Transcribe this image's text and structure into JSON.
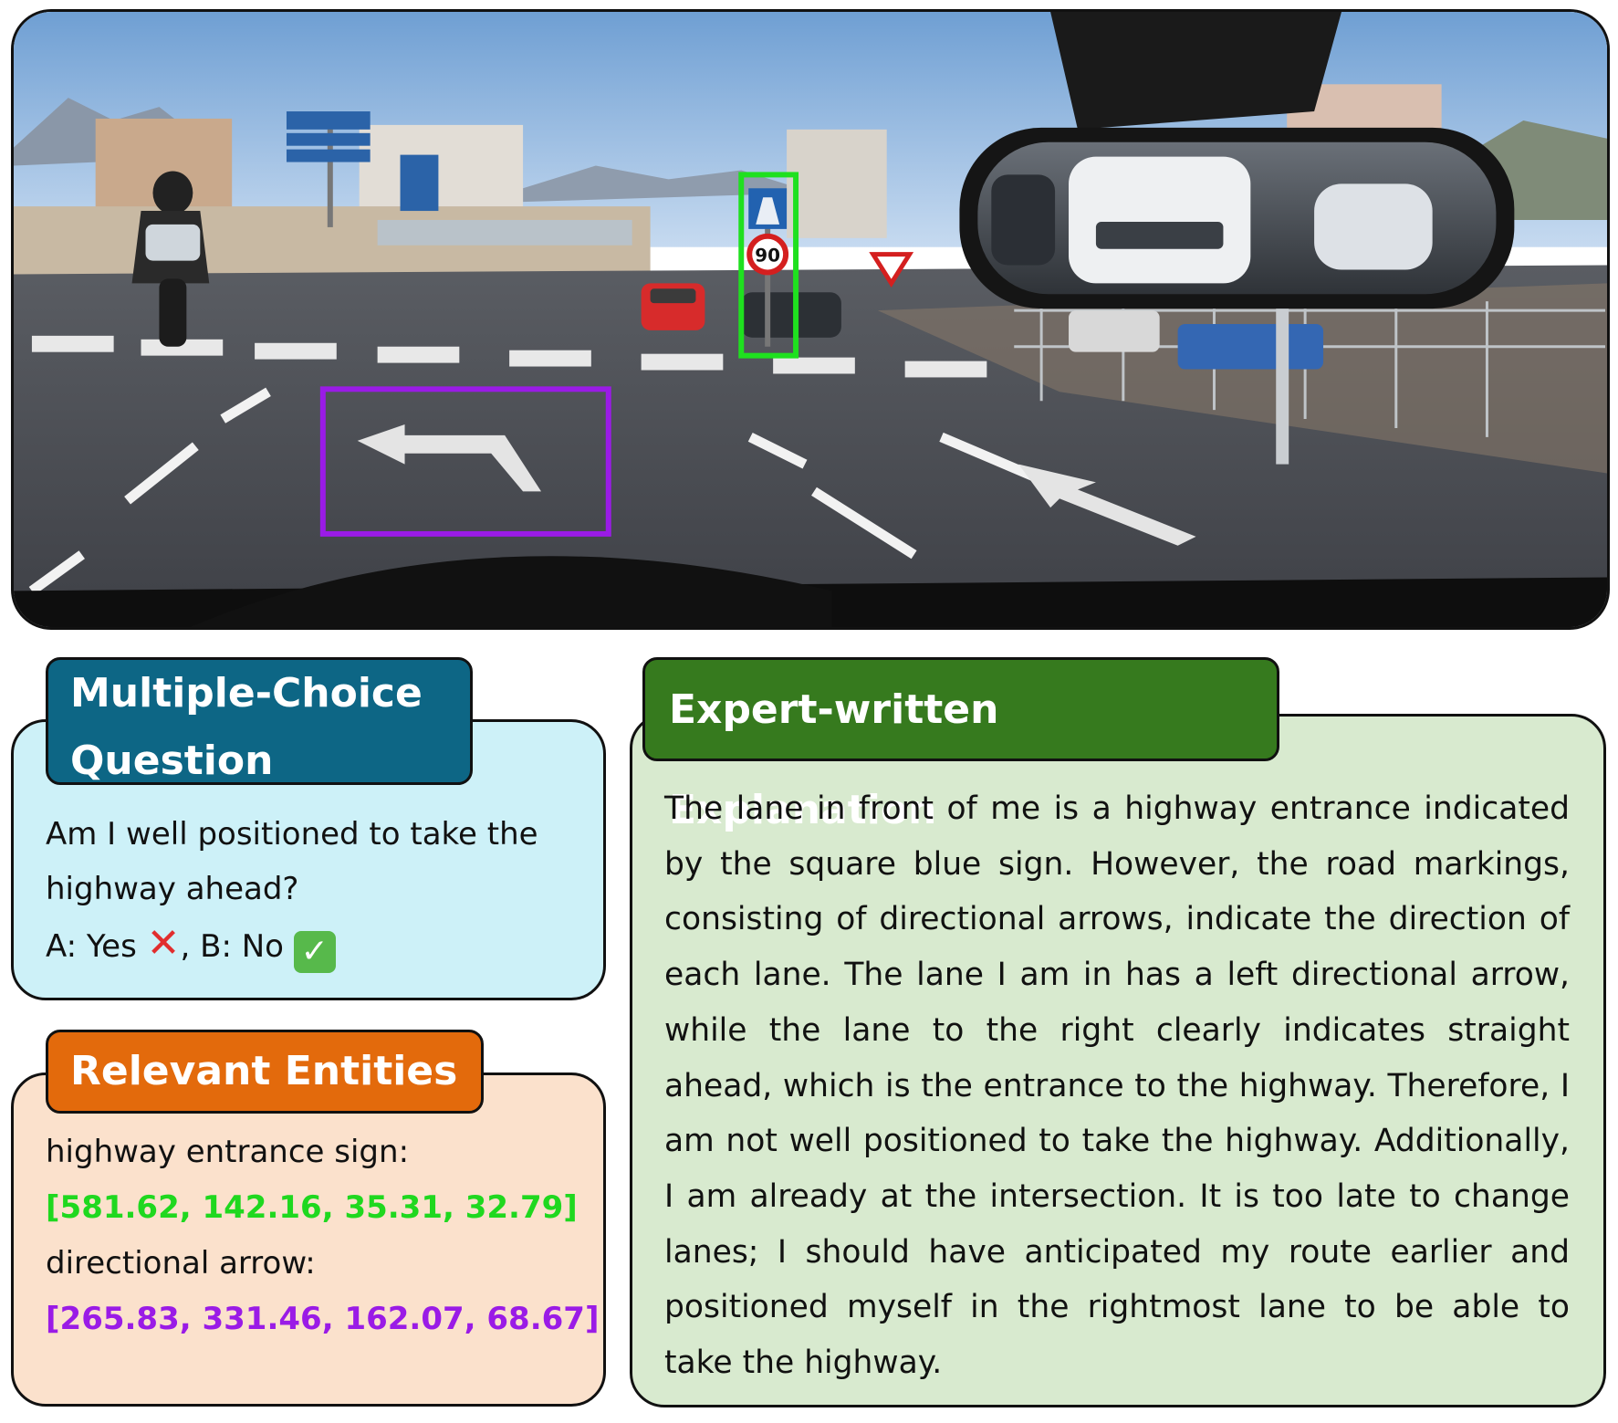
{
  "image": {
    "speed_sign": "90",
    "box_colors": {
      "entrance_sign": "#1fe01f",
      "arrow": "#9a1be6"
    }
  },
  "mcq": {
    "title": "Multiple-Choice Question",
    "question": "Am I well positioned to take the highway ahead?",
    "option_a": "A: Yes",
    "separator": ", B: No",
    "marks": {
      "a": "✕",
      "b": "✓"
    },
    "mark_icons": {
      "a": "cross-mark-icon",
      "b": "check-mark-icon"
    }
  },
  "entities": {
    "title": "Relevant Entities",
    "items": [
      {
        "label": "highway entrance sign:",
        "box": "[581.62, 142.16, 35.31, 32.79]",
        "color": "#1fd81f"
      },
      {
        "label": "directional arrow:",
        "box": "[265.83, 331.46, 162.07, 68.67]",
        "color": "#9a1be6"
      }
    ]
  },
  "explanation": {
    "title": "Expert-written Explanation",
    "text": "The lane in front of me is a highway entrance indicated by the square blue sign. However, the road markings, consisting of directional arrows, indicate the direction of each lane. The lane I am in has a left directional arrow, while the lane to the right clearly indicates straight ahead, which is the entrance to the highway. Therefore, I am not well positioned to take the highway. Additionally, I am already at the intersection. It is too late to change lanes; I should have anticipated my route earlier and positioned myself in the rightmost lane to be able to take the highway."
  },
  "colors": {
    "mcq_tab": "#0d6685",
    "mcq_bg": "#cdf1f8",
    "entities_tab": "#e36a0c",
    "entities_bg": "#fbe1cc",
    "explanation_tab": "#367a1e",
    "explanation_bg": "#d8eacf"
  }
}
